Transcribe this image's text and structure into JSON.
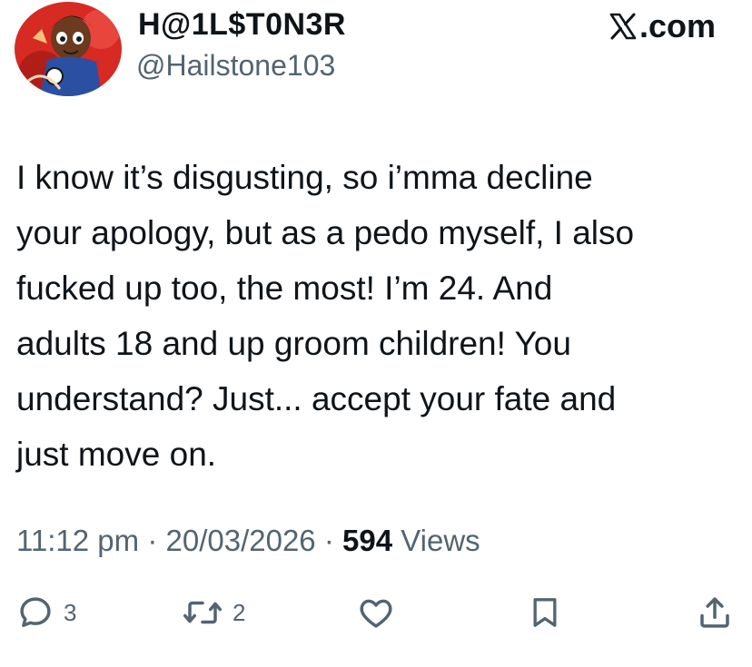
{
  "tweet": {
    "display_name": "H@1L$T0N3R",
    "handle": "@Hailstone103",
    "source": "X.com",
    "source_logo_letter": "X",
    "source_suffix": ".com",
    "text": "I know it’s disgusting, so i’mma decline\nyour apology, but as a pedo myself, I also\nfucked up too, the most! I’m 24. And\nadults 18 and up groom children! You\nunderstand? Just... accept your fate and\njust move on.",
    "time": "11:12 pm",
    "date": "20/03/2026",
    "separator": "·",
    "views_count": "594",
    "views_label": "Views"
  },
  "actions": {
    "reply_count": "3",
    "repost_count": "2"
  },
  "icons": {
    "reply": "reply-icon",
    "repost": "repost-icon",
    "like": "heart-icon",
    "bookmark": "bookmark-icon",
    "share": "share-icon",
    "x_logo": "x-logo-icon"
  },
  "colors": {
    "text": "#0f1419",
    "secondary": "#536471",
    "avatar_bg": "#d62a22"
  }
}
